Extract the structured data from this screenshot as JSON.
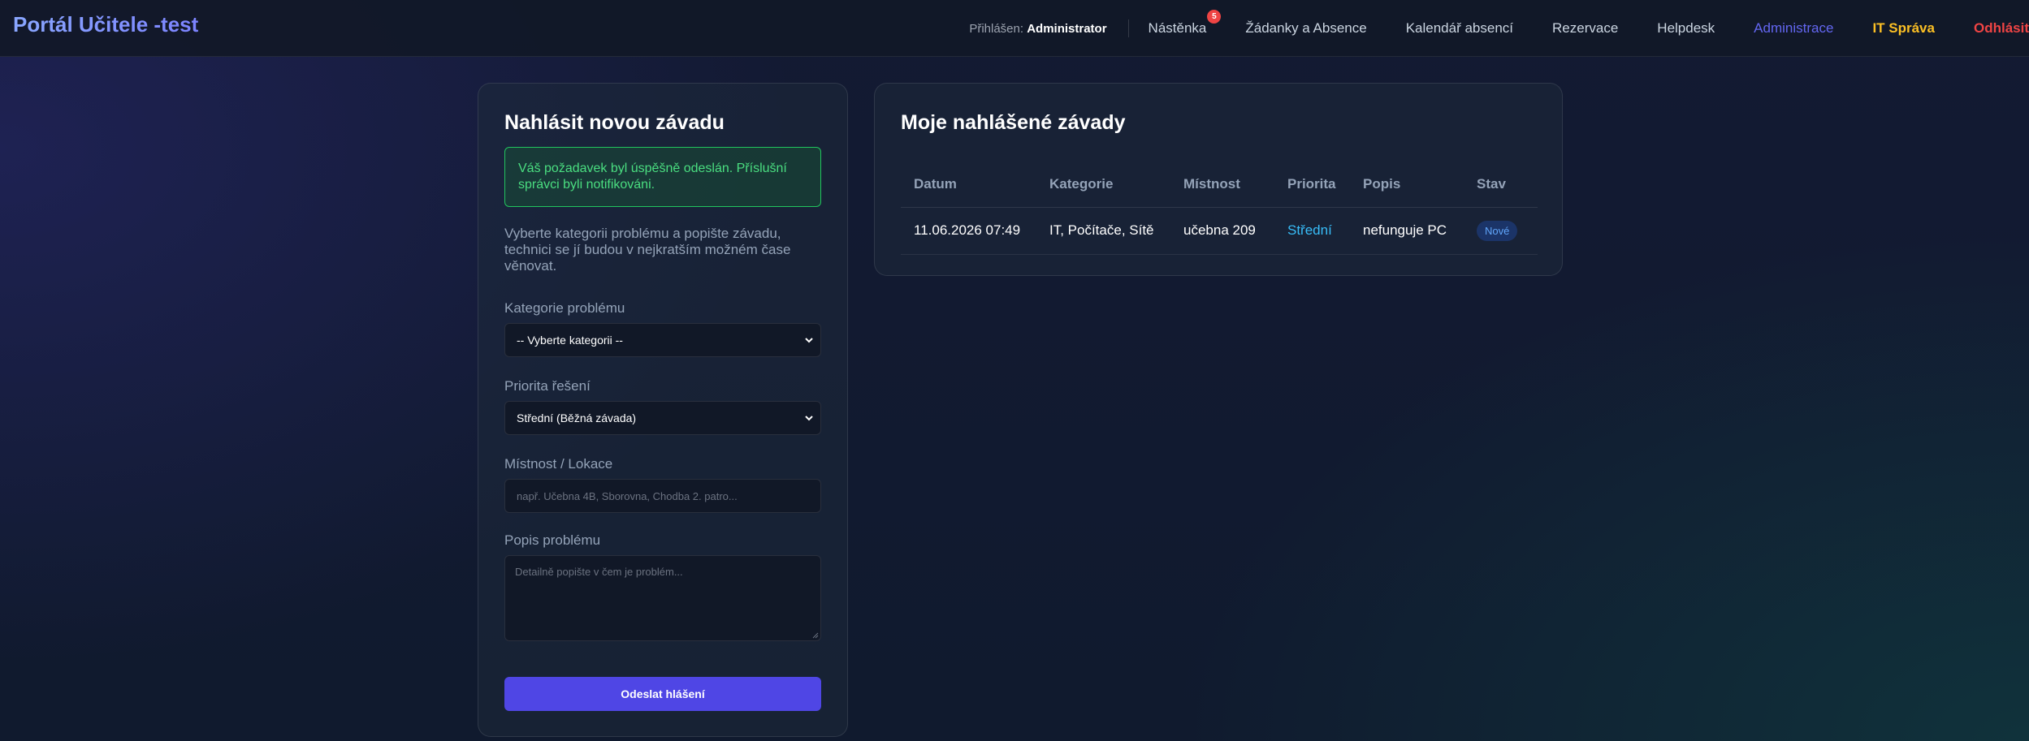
{
  "brand": "Portál Učitele -test",
  "nav": {
    "logged_label": "Přihlášen:",
    "logged_user": "Administrator",
    "items": [
      {
        "label": "Nástěnka",
        "badge": "5"
      },
      {
        "label": "Žádanky a Absence"
      },
      {
        "label": "Kalendář absencí"
      },
      {
        "label": "Rezervace"
      },
      {
        "label": "Helpdesk"
      },
      {
        "label": "Administrace"
      },
      {
        "label": "IT Správa"
      },
      {
        "label": "Odhlásit"
      }
    ]
  },
  "form": {
    "title": "Nahlásit novou závadu",
    "alert": "Váš požadavek byl úspěšně odeslán. Příslušní správci byli notifikováni.",
    "intro": "Vyberte kategorii problému a popište závadu, technici se jí budou v nejkratším možném čase věnovat.",
    "category_label": "Kategorie problému",
    "category_value": "-- Vyberte kategorii --",
    "priority_label": "Priorita řešení",
    "priority_value": "Střední (Běžná závada)",
    "room_label": "Místnost / Lokace",
    "room_placeholder": "např. Učebna 4B, Sborovna, Chodba 2. patro...",
    "desc_label": "Popis problému",
    "desc_placeholder": "Detailně popište v čem je problém...",
    "submit": "Odeslat hlášení"
  },
  "reports": {
    "title": "Moje nahlášené závady",
    "columns": [
      "Datum",
      "Kategorie",
      "Místnost",
      "Priorita",
      "Popis",
      "Stav"
    ],
    "rows": [
      {
        "date": "11.06.2026 07:49",
        "category": "IT, Počítače, Sítě",
        "room": "učebna 209",
        "priority": "Střední",
        "desc": "nefunguje PC",
        "status": "Nové"
      }
    ]
  },
  "colors": {
    "accent": "#4f46e5",
    "success": "#22c55e",
    "admin": "#6366f1",
    "it": "#fbbf24",
    "logout": "#ef4444",
    "priority": "#38bdf8"
  }
}
